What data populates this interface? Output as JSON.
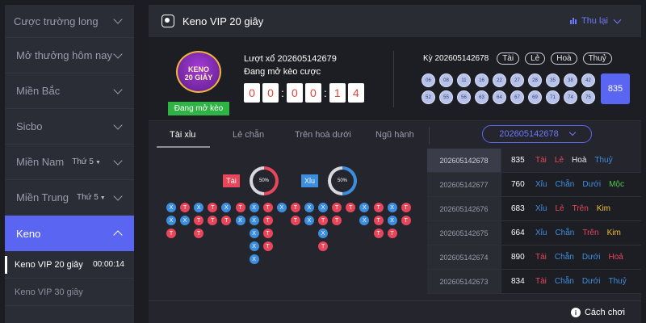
{
  "sidebar": {
    "items": [
      {
        "label": "Cược trường long",
        "sub": ""
      },
      {
        "label": "Mở thưởng hôm nay",
        "sub": ""
      },
      {
        "label": "Miền Bắc",
        "sub": ""
      },
      {
        "label": "Sicbo",
        "sub": ""
      },
      {
        "label": "Miền Nam",
        "sub": "Thứ 5"
      },
      {
        "label": "Miền Trung",
        "sub": "Thứ 5"
      }
    ],
    "active": {
      "label": "Keno"
    },
    "games": [
      {
        "label": "Keno VIP 20 giây",
        "time": "00:00:14"
      },
      {
        "label": "Keno VIP 30 giây",
        "time": ""
      }
    ]
  },
  "header": {
    "title": "Keno VIP 20 giây",
    "collapse_label": "Thu lại"
  },
  "draw": {
    "logo_text": "KENO\n20 GIÂY",
    "status_button": "Đang mở kèo",
    "round_label": "Lượt xổ 202605142679",
    "round_status": "Đang mở kèo cược",
    "countdown": [
      "0",
      "0",
      "0",
      "0",
      "1",
      "4"
    ],
    "period_label": "Kỳ 202605142678",
    "tags": [
      "Tài",
      "Lẻ",
      "Hoà",
      "Thuỷ"
    ],
    "balls": [
      "06",
      "08",
      "11",
      "16",
      "22",
      "27",
      "28",
      "35",
      "38",
      "42",
      "52",
      "55",
      "56",
      "63",
      "64",
      "67",
      "69",
      "71",
      "74",
      "75"
    ],
    "sum": "835"
  },
  "tabs": [
    "Tài xỉu",
    "Lẻ chẵn",
    "Trên hoà dưới",
    "Ngũ hành"
  ],
  "period_select": "202605142678",
  "stats": {
    "tai": {
      "label": "Tài",
      "percent": "50%",
      "value": 50,
      "color": "#e8465a"
    },
    "xiu": {
      "label": "Xỉu",
      "percent": "50%",
      "value": 50,
      "color": "#3e8ee0"
    }
  },
  "roadmap": [
    [
      "X",
      "X",
      "T"
    ],
    [
      "T",
      "X"
    ],
    [
      "X",
      "T",
      "T"
    ],
    [
      "T",
      "T"
    ],
    [
      "X",
      "T"
    ],
    [
      "T",
      "X"
    ],
    [
      "X",
      "X",
      "X",
      "X",
      "X"
    ],
    [
      "T",
      "T",
      "T",
      "T"
    ],
    [
      "X"
    ],
    [
      "T",
      "T"
    ],
    [
      "X",
      "X"
    ],
    [
      "X",
      "T",
      "X",
      "T"
    ],
    [
      "T",
      "T"
    ],
    [
      "T"
    ],
    [
      "X",
      "X"
    ],
    [
      "T",
      "T",
      "T"
    ],
    [
      "X",
      "X",
      "T"
    ],
    [
      "T",
      "T"
    ]
  ],
  "history": [
    {
      "id": "202605142678",
      "sum": "835",
      "r": [
        {
          "t": "Tài",
          "c": "red"
        },
        {
          "t": "Lẻ",
          "c": "red"
        },
        {
          "t": "Hoà",
          "c": "white"
        },
        {
          "t": "Thuỷ",
          "c": "blue"
        }
      ]
    },
    {
      "id": "202605142677",
      "sum": "760",
      "r": [
        {
          "t": "Xỉu",
          "c": "blue"
        },
        {
          "t": "Chẵn",
          "c": "blue"
        },
        {
          "t": "Dưới",
          "c": "blue"
        },
        {
          "t": "Mộc",
          "c": "green"
        }
      ]
    },
    {
      "id": "202605142676",
      "sum": "683",
      "r": [
        {
          "t": "Xỉu",
          "c": "blue"
        },
        {
          "t": "Lẻ",
          "c": "red"
        },
        {
          "t": "Trên",
          "c": "red"
        },
        {
          "t": "Kim",
          "c": "yellow"
        }
      ]
    },
    {
      "id": "202605142675",
      "sum": "664",
      "r": [
        {
          "t": "Xỉu",
          "c": "blue"
        },
        {
          "t": "Chẵn",
          "c": "blue"
        },
        {
          "t": "Trên",
          "c": "red"
        },
        {
          "t": "Kim",
          "c": "yellow"
        }
      ]
    },
    {
      "id": "202605142674",
      "sum": "890",
      "r": [
        {
          "t": "Tài",
          "c": "red"
        },
        {
          "t": "Chẵn",
          "c": "blue"
        },
        {
          "t": "Dưới",
          "c": "blue"
        },
        {
          "t": "Hoả",
          "c": "red"
        }
      ]
    },
    {
      "id": "202605142673",
      "sum": "834",
      "r": [
        {
          "t": "Tài",
          "c": "red"
        },
        {
          "t": "Chẵn",
          "c": "blue"
        },
        {
          "t": "Dưới",
          "c": "blue"
        },
        {
          "t": "Thuỷ",
          "c": "blue"
        }
      ]
    }
  ],
  "footer": {
    "howto": "Cách chơi"
  },
  "icons": [
    "chevron-down-icon",
    "chevron-up-icon",
    "keno-icon",
    "collapse-bars-icon",
    "info-icon"
  ]
}
